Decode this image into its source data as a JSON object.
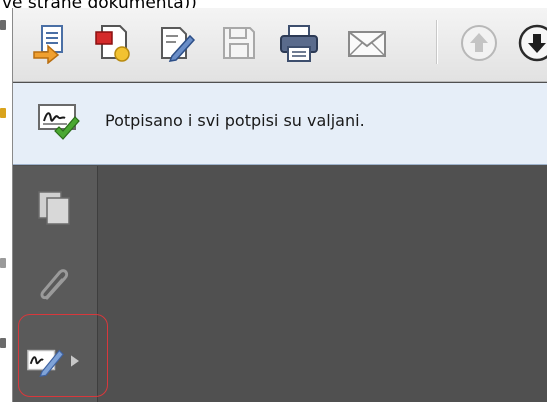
{
  "caption": {
    "text": "ve strane dokumenta))"
  },
  "toolbar": {
    "buttons": [
      {
        "name": "export-icon"
      },
      {
        "name": "create-icon"
      },
      {
        "name": "edit-icon"
      },
      {
        "name": "save-icon"
      },
      {
        "name": "print-icon"
      },
      {
        "name": "email-icon"
      },
      {
        "name": "previous-page-icon"
      },
      {
        "name": "next-page-icon"
      }
    ]
  },
  "signature_bar": {
    "message": "Potpisano i svi potpisi su valjani.",
    "icon": "signature-valid-icon"
  },
  "navigation_panel": {
    "buttons": [
      {
        "name": "pages-icon"
      },
      {
        "name": "attachments-icon"
      },
      {
        "name": "signatures-icon"
      }
    ]
  },
  "colors": {
    "highlight": "#d8383c",
    "panel": "#5a5a5a",
    "content": "#505050",
    "signature_bar": "#e6eef8"
  }
}
